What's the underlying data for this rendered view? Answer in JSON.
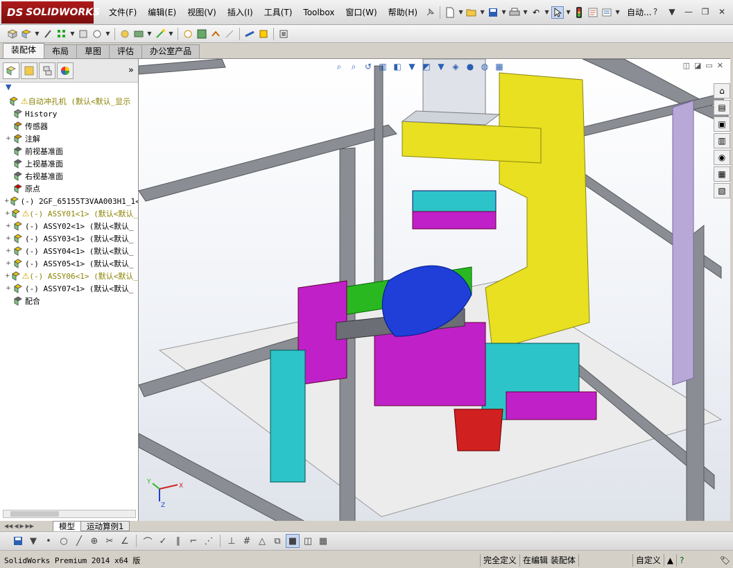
{
  "app": {
    "logo_ds": "DS",
    "logo_text": "SOLIDWORKS"
  },
  "menu": [
    "文件(F)",
    "编辑(E)",
    "视图(V)",
    "插入(I)",
    "工具(T)",
    "Toolbox",
    "窗口(W)",
    "帮助(H)"
  ],
  "title_right": "自动...",
  "help_icon": "?",
  "cm_tabs": [
    "装配体",
    "布局",
    "草图",
    "评估",
    "办公室产品"
  ],
  "pane_more": "»",
  "tree": [
    {
      "label": "自动冲孔机  (默认<默认_显示",
      "icon": "assembly-icon",
      "warn": true,
      "expand": "",
      "indent": 0
    },
    {
      "label": "History",
      "icon": "history-icon",
      "warn": false,
      "expand": "",
      "indent": 1
    },
    {
      "label": "传感器",
      "icon": "sensor-icon",
      "warn": false,
      "expand": "",
      "indent": 1
    },
    {
      "label": "注解",
      "icon": "annotation-icon",
      "warn": false,
      "expand": "+",
      "indent": 1
    },
    {
      "label": "前视基准面",
      "icon": "plane-icon",
      "warn": false,
      "expand": "",
      "indent": 1
    },
    {
      "label": "上视基准面",
      "icon": "plane-icon",
      "warn": false,
      "expand": "",
      "indent": 1
    },
    {
      "label": "右视基准面",
      "icon": "plane-icon",
      "warn": false,
      "expand": "",
      "indent": 1
    },
    {
      "label": "原点",
      "icon": "origin-icon",
      "warn": false,
      "expand": "",
      "indent": 1
    },
    {
      "label": "(-) 2GF_65155T3VAA003H1_1<",
      "icon": "part-icon",
      "warn": false,
      "expand": "+",
      "indent": 1
    },
    {
      "label": "(-) ASSY01<1> (默认<默认_",
      "icon": "assembly-icon",
      "warn": true,
      "expand": "+",
      "indent": 1
    },
    {
      "label": "(-) ASSY02<1> (默认<默认_",
      "icon": "assembly-icon",
      "warn": false,
      "expand": "+",
      "indent": 1
    },
    {
      "label": "(-) ASSY03<1> (默认<默认_",
      "icon": "assembly-icon",
      "warn": false,
      "expand": "+",
      "indent": 1
    },
    {
      "label": "(-) ASSY04<1> (默认<默认_",
      "icon": "assembly-icon",
      "warn": false,
      "expand": "+",
      "indent": 1
    },
    {
      "label": "(-) ASSY05<1> (默认<默认_",
      "icon": "assembly-icon",
      "warn": false,
      "expand": "+",
      "indent": 1
    },
    {
      "label": "(-) ASSY06<1> (默认<默认_",
      "icon": "assembly-icon",
      "warn": true,
      "expand": "+",
      "indent": 1
    },
    {
      "label": "(-) ASSY07<1> (默认<默认_",
      "icon": "assembly-icon",
      "warn": false,
      "expand": "+",
      "indent": 1
    },
    {
      "label": "配合",
      "icon": "mates-icon",
      "warn": false,
      "expand": "",
      "indent": 1
    }
  ],
  "bottom_tabs": [
    "模型",
    "运动算例1"
  ],
  "status": {
    "version": "SolidWorks Premium 2014 x64 版",
    "constraint": "完全定义",
    "editing": "在编辑 装配体",
    "units": "自定义",
    "help": "?"
  },
  "triad": {
    "x": "X",
    "y": "Y",
    "z": "Z"
  },
  "colors": {
    "frame": "#8a8d93",
    "yellow": "#e8e020",
    "cyan": "#2cc4c8",
    "magenta": "#c020c8",
    "green": "#2ab820",
    "blue": "#1f3fd8",
    "red": "#d02020",
    "titlebar_logo": "#a01818"
  }
}
